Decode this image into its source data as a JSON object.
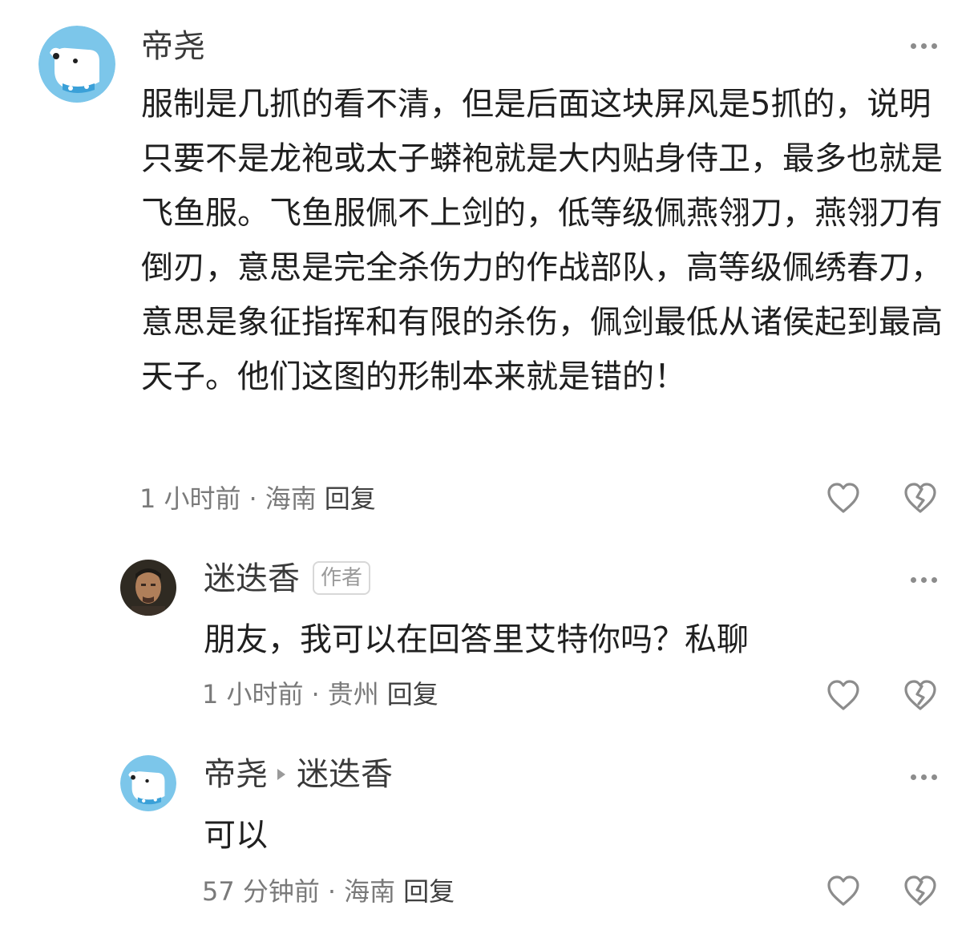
{
  "comments": [
    {
      "author": "帝尧",
      "text": "服制是几抓的看不清，但是后面这块屏风是5抓的，说明只要不是龙袍或太子蟒袍就是大内贴身侍卫，最多也就是飞鱼服。飞鱼服佩不上剑的，低等级佩燕翎刀，燕翎刀有倒刃，意思是完全杀伤力的作战部队，高等级佩绣春刀，意思是象征指挥和有限的杀伤，佩剑最低从诸侯起到最高天子。他们这图的形制本来就是错的！",
      "time": "1 小时前",
      "location": "海南",
      "reply_label": "回复",
      "avatar_icon": "dog-avatar-icon"
    },
    {
      "author": "迷迭香",
      "badge": "作者",
      "text": "朋友，我可以在回答里艾特你吗？私聊",
      "time": "1 小时前",
      "location": "贵州",
      "reply_label": "回复",
      "avatar_icon": "photo-avatar"
    },
    {
      "author": "帝尧",
      "reply_to": "迷迭香",
      "text": "可以",
      "time": "57 分钟前",
      "location": "海南",
      "reply_label": "回复",
      "avatar_icon": "dog-avatar-icon"
    }
  ],
  "icons": {
    "like": "heart-icon",
    "dislike": "broken-heart-icon",
    "more": "more-dots-icon"
  },
  "colors": {
    "name": "#3a3a3a",
    "meta": "#7a7a7a",
    "icon": "#8c8c8c",
    "avatar_bg": "#7cc6ea"
  }
}
